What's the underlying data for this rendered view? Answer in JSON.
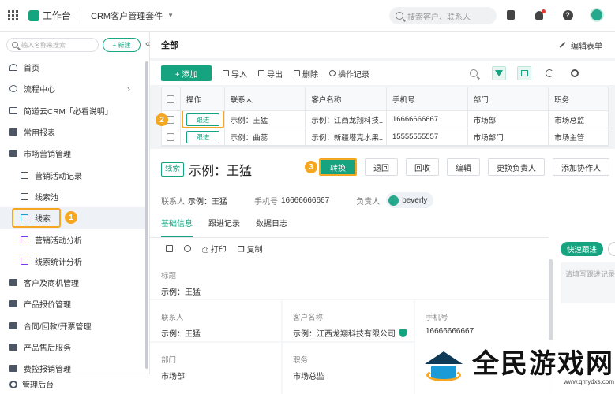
{
  "topbar": {
    "workspace": "工作台",
    "app_name": "CRM客户管理套件",
    "search_placeholder": "搜索客户、联系人"
  },
  "sidebar": {
    "search_placeholder": "输入名称来搜索",
    "new_label": "+ 新建",
    "items": [
      {
        "label": "首页",
        "icon": "home-icon"
      },
      {
        "label": "流程中心",
        "icon": "flow-icon"
      },
      {
        "label": "简道云CRM「必看说明」",
        "icon": "doc-icon"
      },
      {
        "label": "常用报表",
        "icon": "folder-icon"
      },
      {
        "label": "市场营销管理",
        "icon": "folder-icon"
      },
      {
        "label": "营销活动记录",
        "icon": "doc-icon"
      },
      {
        "label": "线索池",
        "icon": "doc-icon"
      },
      {
        "label": "线索",
        "icon": "lead-icon"
      },
      {
        "label": "营销活动分析",
        "icon": "chart-icon"
      },
      {
        "label": "线索统计分析",
        "icon": "chart-icon"
      },
      {
        "label": "客户及商机管理",
        "icon": "folder-icon"
      },
      {
        "label": "产品报价管理",
        "icon": "folder-icon"
      },
      {
        "label": "合同/回款/开票管理",
        "icon": "folder-icon"
      },
      {
        "label": "产品售后服务",
        "icon": "folder-icon"
      },
      {
        "label": "费控报销管理",
        "icon": "folder-icon"
      }
    ],
    "footer": "管理后台"
  },
  "main": {
    "title": "全部",
    "edit_form": "编辑表单",
    "toolbar": {
      "add": "+ 添加",
      "import": "导入",
      "export": "导出",
      "delete": "删除",
      "ops_log": "操作记录"
    },
    "table": {
      "headers": [
        "操作",
        "联系人",
        "客户名称",
        "手机号",
        "部门",
        "职务"
      ],
      "rows": [
        {
          "action": "跟进",
          "contact": "示例：王猛",
          "customer": "示例：江西龙翔科技...",
          "phone": "16666666667",
          "dept": "市场部",
          "title": "市场总监"
        },
        {
          "action": "跟进",
          "contact": "示例：曲蕊",
          "customer": "示例：新疆塔克水果...",
          "phone": "15555555557",
          "dept": "市场部门",
          "title": "市场主管"
        }
      ]
    }
  },
  "detail": {
    "tag": "线索",
    "name": "示例：王猛",
    "buttons": {
      "convert": "转换",
      "back": "退回",
      "recycle": "回收",
      "edit": "编辑",
      "change_owner": "更换负责人",
      "add_collab": "添加协作人"
    },
    "meta": {
      "contact_label": "联系人",
      "contact_value": "示例：王猛",
      "phone_label": "手机号",
      "phone_value": "16666666667",
      "owner_label": "负责人",
      "owner_value": "beverly"
    },
    "tabs": [
      "基础信息",
      "跟进记录",
      "数据日志"
    ],
    "subtoolbar": {
      "print": "打印",
      "copy": "复制"
    },
    "fields": {
      "title_label": "标题",
      "title_value": "示例：王猛",
      "contact_label": "联系人",
      "contact_value": "示例：王猛",
      "customer_label": "客户名称",
      "customer_value": "示例：江西龙翔科技有限公司",
      "phone_label": "手机号",
      "phone_value": "16666666667",
      "dept_label": "部门",
      "dept_value": "市场部",
      "job_label": "职务",
      "job_value": "市场总监"
    },
    "quick_follow": "快速跟进",
    "follow_placeholder": "请填写跟进记录"
  },
  "badges": [
    "1",
    "2",
    "3"
  ],
  "watermark": {
    "text": "全民游戏网",
    "url": "www.qmydxs.com"
  },
  "colors": {
    "accent": "#16a37f",
    "highlight": "#f5a623"
  }
}
